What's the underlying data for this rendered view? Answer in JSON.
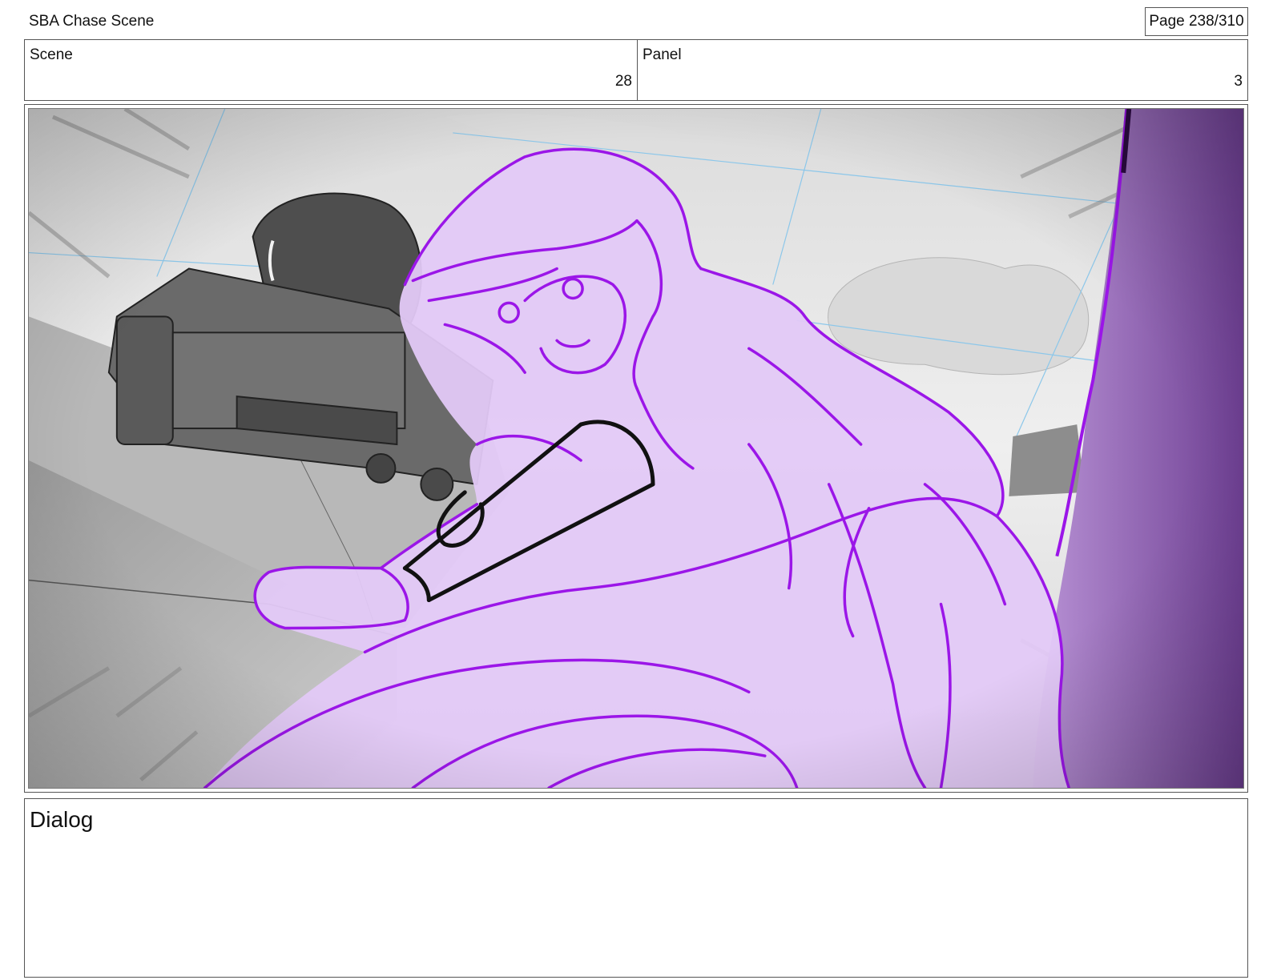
{
  "document": {
    "title": "SBA Chase Scene",
    "page_indicator": "Page 238/310"
  },
  "info": {
    "scene_label": "Scene",
    "scene_value": "28",
    "panel_label": "Panel",
    "panel_value": "3"
  },
  "artwork": {
    "description_icon": "storyboard-sketch",
    "colors": {
      "sketch_stroke": "#9b16e8",
      "sketch_fill": "#e3c9f7",
      "cannon": "#5a5a5a",
      "background": "#e8e8e8",
      "guide_lines": "#8cc7ea"
    }
  },
  "dialog": {
    "label": "Dialog"
  }
}
